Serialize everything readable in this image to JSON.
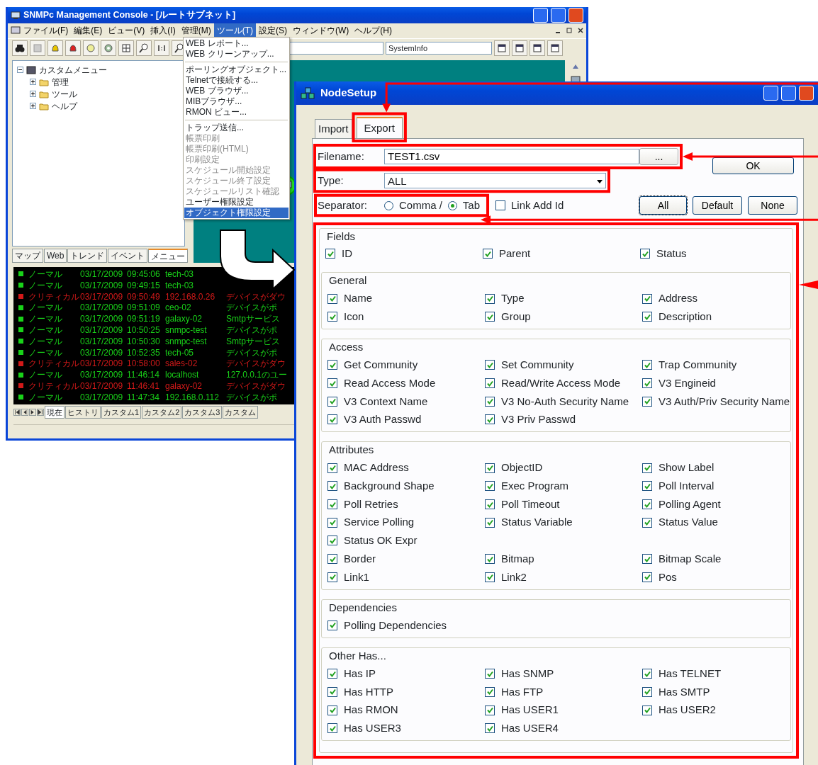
{
  "main_window": {
    "title": "SNMPc Management Console - [ルートサブネット]",
    "menu": [
      {
        "label": "ファイル(F)",
        "selected": false
      },
      {
        "label": "編集(E)",
        "selected": false
      },
      {
        "label": "ビュー(V)",
        "selected": false
      },
      {
        "label": "挿入(I)",
        "selected": false
      },
      {
        "label": "管理(M)",
        "selected": false
      },
      {
        "label": "ツール(T)",
        "selected": true
      },
      {
        "label": "設定(S)",
        "selected": false
      },
      {
        "label": "ウィンドウ(W)",
        "selected": false
      },
      {
        "label": "ヘルプ(H)",
        "selected": false
      }
    ],
    "tools_menu": [
      {
        "label": "WEB レポート...",
        "disabled": false,
        "selected": false
      },
      {
        "label": "WEB クリーンアップ...",
        "disabled": false,
        "selected": false,
        "separator_after": true
      },
      {
        "label": "ポーリングオブジェクト...",
        "disabled": false,
        "selected": false
      },
      {
        "label": "Telnetで接続する...",
        "disabled": false,
        "selected": false
      },
      {
        "label": "WEB ブラウザ...",
        "disabled": false,
        "selected": false
      },
      {
        "label": "MIBブラウザ...",
        "disabled": false,
        "selected": false
      },
      {
        "label": "RMON ビュー...",
        "disabled": false,
        "selected": false,
        "separator_after": true
      },
      {
        "label": "トラップ送信...",
        "disabled": false,
        "selected": false
      },
      {
        "label": "帳票印刷",
        "disabled": true,
        "selected": false
      },
      {
        "label": "帳票印刷(HTML)",
        "disabled": true,
        "selected": false
      },
      {
        "label": "印刷設定",
        "disabled": true,
        "selected": false
      },
      {
        "label": "スケジュール開始設定",
        "disabled": true,
        "selected": false
      },
      {
        "label": "スケジュール終了設定",
        "disabled": true,
        "selected": false
      },
      {
        "label": "スケジュールリスト確認",
        "disabled": true,
        "selected": false
      },
      {
        "label": "ユーザー権限設定",
        "disabled": false,
        "selected": false
      },
      {
        "label": "オブジェクト権限設定",
        "disabled": false,
        "selected": true
      }
    ],
    "combo_value": "SystemInfo",
    "tree": {
      "label": "カスタムメニュー",
      "expanded": true,
      "children": [
        {
          "label": "管理",
          "expanded": false
        },
        {
          "label": "ツール",
          "expanded": false
        },
        {
          "label": "ヘルプ",
          "expanded": false
        }
      ]
    },
    "left_tabs": [
      {
        "label": "マップ",
        "selected": false
      },
      {
        "label": "Web",
        "selected": false
      },
      {
        "label": "トレンド",
        "selected": false
      },
      {
        "label": "イベント",
        "selected": false
      },
      {
        "label": "メニュー",
        "selected": true
      }
    ],
    "event_log": [
      {
        "color": "#19d219",
        "severity": "ノーマル",
        "date": "03/17/2009",
        "time": "09:45:06",
        "source": "tech-03"
      },
      {
        "color": "#19d219",
        "severity": "ノーマル",
        "date": "03/17/2009",
        "time": "09:49:15",
        "source": "tech-03"
      },
      {
        "color": "#d21919",
        "severity": "クリティカル",
        "date": "03/17/2009",
        "time": "09:50:49",
        "source": "192.168.0.26",
        "message": "デバイスがダウ"
      },
      {
        "color": "#19d219",
        "severity": "ノーマル",
        "date": "03/17/2009",
        "time": "09:51:09",
        "source": "ceo-02",
        "message": "デバイスがポ"
      },
      {
        "color": "#19d219",
        "severity": "ノーマル",
        "date": "03/17/2009",
        "time": "09:51:19",
        "source": "galaxy-02",
        "message": "Smtpサービス"
      },
      {
        "color": "#19d219",
        "severity": "ノーマル",
        "date": "03/17/2009",
        "time": "10:50:25",
        "source": "snmpc-test",
        "message": "デバイスがポ"
      },
      {
        "color": "#19d219",
        "severity": "ノーマル",
        "date": "03/17/2009",
        "time": "10:50:30",
        "source": "snmpc-test",
        "message": "Smtpサービス"
      },
      {
        "color": "#19d219",
        "severity": "ノーマル",
        "date": "03/17/2009",
        "time": "10:52:35",
        "source": "tech-05",
        "message": "デバイスがポ"
      },
      {
        "color": "#d21919",
        "severity": "クリティカル",
        "date": "03/17/2009",
        "time": "10:58:00",
        "source": "sales-02",
        "message": "デバイスがダウ"
      },
      {
        "color": "#19d219",
        "severity": "ノーマル",
        "date": "03/17/2009",
        "time": "11:46:14",
        "source": "localhost",
        "message": "127.0.0.1のユー"
      },
      {
        "color": "#d21919",
        "severity": "クリティカル",
        "date": "03/17/2009",
        "time": "11:46:41",
        "source": "galaxy-02",
        "message": "デバイスがダウ"
      },
      {
        "color": "#19d219",
        "severity": "ノーマル",
        "date": "03/17/2009",
        "time": "11:47:34",
        "source": "192.168.0.112",
        "message": "デバイスがポ"
      }
    ],
    "log_tabs": [
      {
        "label": "現在",
        "selected": true
      },
      {
        "label": "ヒストリ",
        "selected": false
      },
      {
        "label": "カスタム1",
        "selected": false
      },
      {
        "label": "カスタム2",
        "selected": false
      },
      {
        "label": "カスタム3",
        "selected": false
      },
      {
        "label": "カスタム",
        "selected": false
      }
    ]
  },
  "dialog": {
    "title": "NodeSetup",
    "tabs": [
      {
        "label": "Import",
        "selected": false
      },
      {
        "label": "Export",
        "selected": true
      }
    ],
    "filename_label": "Filename:",
    "filename": "TEST1.csv",
    "browse_button": "...",
    "type_label": "Type:",
    "type": "ALL",
    "separator_label": "Separator:",
    "separator_options": [
      {
        "label": "Comma /",
        "selected": false
      },
      {
        "label": "Tab",
        "selected": true
      }
    ],
    "link_add_id": {
      "label": "Link Add Id",
      "checked": false
    },
    "ok_button": "OK",
    "select_buttons": [
      "All",
      "Default",
      "None"
    ],
    "fields_label": "Fields",
    "top_fields": [
      [
        {
          "label": "ID",
          "checked": true
        },
        {
          "label": "Parent",
          "checked": true
        },
        {
          "label": "Status",
          "checked": true
        }
      ]
    ],
    "groups": [
      {
        "title": "General",
        "rows": [
          [
            {
              "label": "Name",
              "checked": true
            },
            {
              "label": "Type",
              "checked": true
            },
            {
              "label": "Address",
              "checked": true
            }
          ],
          [
            {
              "label": "Icon",
              "checked": true
            },
            {
              "label": "Group",
              "checked": true
            },
            {
              "label": "Description",
              "checked": true
            }
          ]
        ]
      },
      {
        "title": "Access",
        "rows": [
          [
            {
              "label": "Get Community",
              "checked": true
            },
            {
              "label": "Set Community",
              "checked": true
            },
            {
              "label": "Trap Community",
              "checked": true
            }
          ],
          [
            {
              "label": "Read Access Mode",
              "checked": true
            },
            {
              "label": "Read/Write Access Mode",
              "checked": true
            },
            {
              "label": "V3 Engineid",
              "checked": true
            }
          ],
          [
            {
              "label": "V3 Context Name",
              "checked": true
            },
            {
              "label": "V3 No-Auth Security Name",
              "checked": true
            },
            {
              "label": "V3 Auth/Priv Security Name",
              "checked": true
            }
          ],
          [
            {
              "label": "V3 Auth Passwd",
              "checked": true
            },
            {
              "label": "V3 Priv Passwd",
              "checked": true
            }
          ]
        ]
      },
      {
        "title": "Attributes",
        "rows": [
          [
            {
              "label": "MAC Address",
              "checked": true
            },
            {
              "label": "ObjectID",
              "checked": true
            },
            {
              "label": "Show Label",
              "checked": true
            }
          ],
          [
            {
              "label": "Background Shape",
              "checked": true
            },
            {
              "label": "Exec Program",
              "checked": true
            },
            {
              "label": "Poll Interval",
              "checked": true
            }
          ],
          [
            {
              "label": "Poll Retries",
              "checked": true
            },
            {
              "label": "Poll Timeout",
              "checked": true
            },
            {
              "label": "Polling Agent",
              "checked": true
            }
          ],
          [
            {
              "label": "Service Polling",
              "checked": true
            },
            {
              "label": "Status Variable",
              "checked": true
            },
            {
              "label": "Status Value",
              "checked": true
            }
          ],
          [
            {
              "label": "Status OK Expr",
              "checked": true
            }
          ],
          [
            {
              "label": "Border",
              "checked": true
            },
            {
              "label": "Bitmap",
              "checked": true
            },
            {
              "label": "Bitmap Scale",
              "checked": true
            }
          ],
          [
            {
              "label": "Link1",
              "checked": true
            },
            {
              "label": "Link2",
              "checked": true
            },
            {
              "label": "Pos",
              "checked": true
            }
          ]
        ]
      },
      {
        "title": "Dependencies",
        "rows": [
          [
            {
              "label": "Polling Dependencies",
              "checked": true
            }
          ]
        ]
      },
      {
        "title": "Other Has...",
        "rows": [
          [
            {
              "label": "Has IP",
              "checked": true
            },
            {
              "label": "Has SNMP",
              "checked": true
            },
            {
              "label": "Has TELNET",
              "checked": true
            }
          ],
          [
            {
              "label": "Has HTTP",
              "checked": true
            },
            {
              "label": "Has FTP",
              "checked": true
            },
            {
              "label": "Has SMTP",
              "checked": true
            }
          ],
          [
            {
              "label": "Has RMON",
              "checked": true
            },
            {
              "label": "Has USER1",
              "checked": true
            },
            {
              "label": "Has USER2",
              "checked": true
            }
          ],
          [
            {
              "label": "Has USER3",
              "checked": true
            },
            {
              "label": "Has USER4",
              "checked": true
            }
          ]
        ]
      }
    ]
  }
}
